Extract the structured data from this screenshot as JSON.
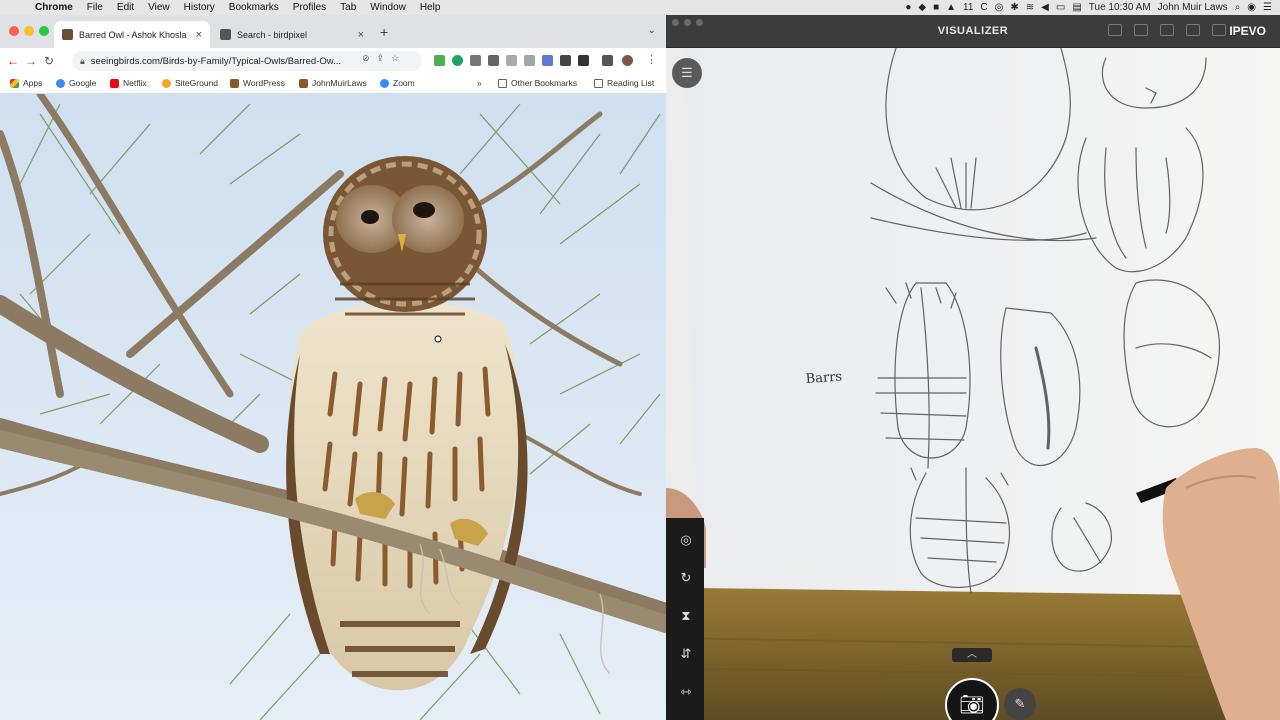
{
  "menubar": {
    "app": "Chrome",
    "items": [
      "File",
      "Edit",
      "View",
      "History",
      "Bookmarks",
      "Profiles",
      "Tab",
      "Window",
      "Help"
    ],
    "right_items": {
      "time": "Tue 10:30 AM",
      "user": "John Muir Laws",
      "badge": "11"
    }
  },
  "browser": {
    "tabs": [
      {
        "title": "Barred Owl - Ashok Khosla",
        "active": true
      },
      {
        "title": "Search - birdpixel",
        "active": false
      }
    ],
    "url": "seeingbirds.com/Birds-by-Family/Typical-Owls/Barred-Ow...",
    "bookmarks": [
      {
        "label": "Apps"
      },
      {
        "label": "Google"
      },
      {
        "label": "Netflix"
      },
      {
        "label": "SiteGround"
      },
      {
        "label": "WordPress"
      },
      {
        "label": "JohnMuirLaws"
      },
      {
        "label": "Zoom"
      },
      {
        "label": "Other Bookmarks"
      },
      {
        "label": "Reading List"
      }
    ],
    "overflow": "»"
  },
  "visualizer": {
    "title": "VISUALIZER",
    "brand": "IPEVO",
    "sketch_label": "Barrs"
  },
  "colors": {
    "sky": "#dce9f5",
    "paper": "#f2f3f5",
    "desk": "#8a6d2a",
    "owl_cream": "#e9dcc0",
    "owl_brown": "#7a4e28"
  }
}
